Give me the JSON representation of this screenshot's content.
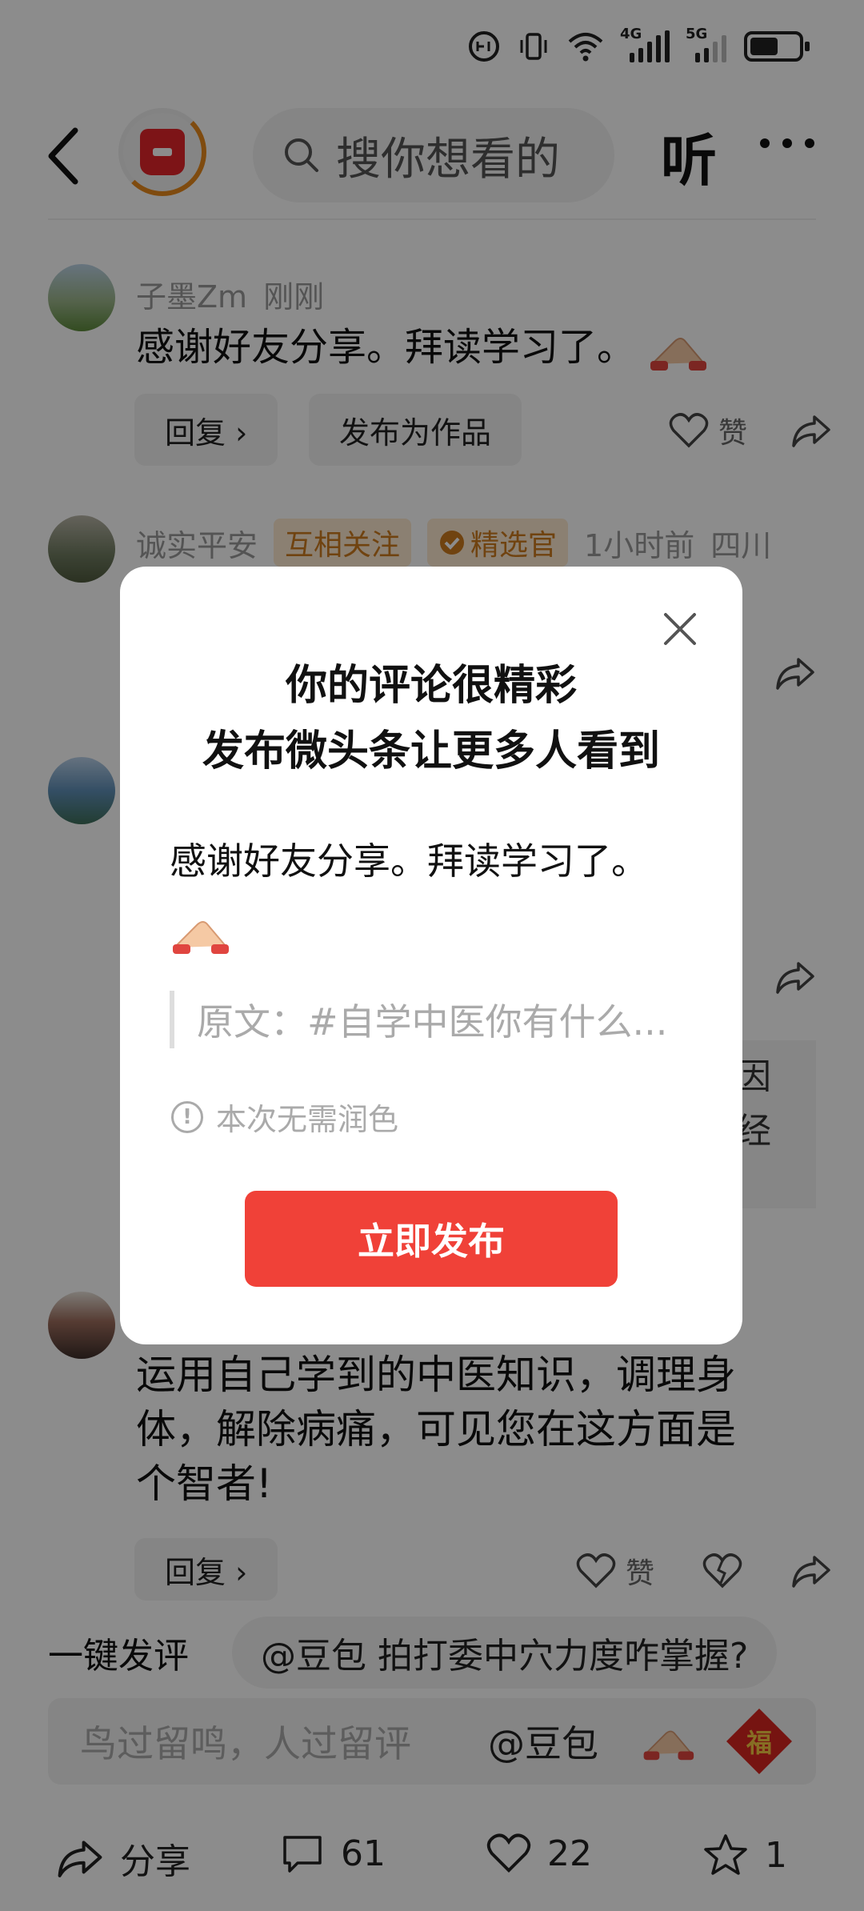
{
  "status": {
    "left_text": "",
    "network1": "4G",
    "network2": "5G"
  },
  "header": {
    "search_placeholder": "搜你想看的",
    "listen_label": "听"
  },
  "comments": [
    {
      "user": "子墨Zm",
      "time": "刚刚",
      "text": "感谢好友分享。拜读学习了。",
      "reply_label": "回复 ›",
      "publish_label": "发布为作品",
      "like_label": "赞"
    },
    {
      "user": "诚实平安",
      "tag_mutual": "互相关注",
      "tag_selected": "精选官",
      "time": "1小时前",
      "location": "四川"
    },
    {
      "quote_partial_1": "因",
      "quote_partial_2": "经"
    },
    {
      "text": "运用自己学到的中医知识，调理身体，解除病痛，可见您在这方面是个智者!",
      "line1": "运用自己学到的中医知识，调理身",
      "line2": "体，解除病痛，可见您在这方面是",
      "line3": "个智者!",
      "reply_label": "回复 ›",
      "like_label": "赞"
    }
  ],
  "quick": {
    "label": "一键发评",
    "chip": "@豆包 拍打委中穴力度咋掌握?"
  },
  "input": {
    "placeholder": "鸟过留鸣，人过留评",
    "at": "@豆包",
    "fu": "福"
  },
  "bottom": {
    "share": "分享",
    "comments": "61",
    "likes": "22",
    "favorites": "1"
  },
  "dialog": {
    "title_line1": "你的评论很精彩",
    "title_line2": "发布微头条让更多人看到",
    "comment": "感谢好友分享。拜读学习了。",
    "original": "原文：#自学中医你有什么...",
    "note": "本次无需润色",
    "publish_button": "立即发布"
  }
}
